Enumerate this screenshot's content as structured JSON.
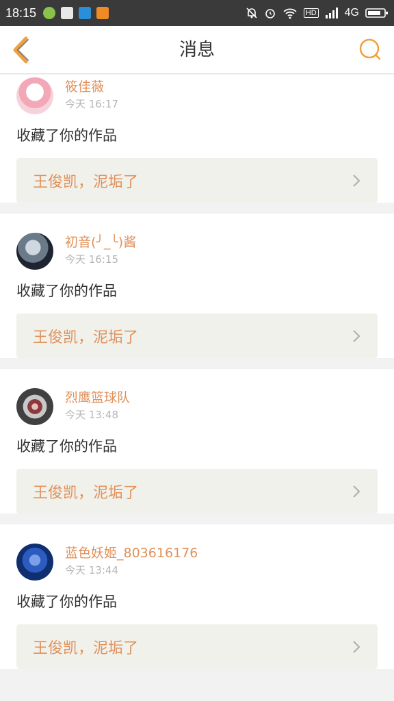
{
  "status_bar": {
    "time": "18:15",
    "network": "4G",
    "hd": "HD",
    "icons": [
      "app-icon-green",
      "app-icon-gallery",
      "app-icon-scan",
      "app-icon-orange",
      "mute-bell-icon",
      "alarm-icon",
      "wifi-icon",
      "hd-icon",
      "signal-icon",
      "battery-icon"
    ]
  },
  "header": {
    "title": "消息",
    "back_icon": "chevron-left-icon",
    "search_icon": "search-icon",
    "accent_color": "#f0a040"
  },
  "messages": [
    {
      "username": "筱佳薇",
      "time": "今天 16:17",
      "action": "收藏了你的作品",
      "work_title": "王俊凯，泥垢了",
      "avatar_color": "#f3d6dc"
    },
    {
      "username": "初音(╯_╰)酱",
      "time": "今天 16:15",
      "action": "收藏了你的作品",
      "work_title": "王俊凯，泥垢了",
      "avatar_color": "#2a3040"
    },
    {
      "username": "烈鹰篮球队",
      "time": "今天 13:48",
      "action": "收藏了你的作品",
      "work_title": "王俊凯，泥垢了",
      "avatar_color": "#5a3a3a"
    },
    {
      "username": "蓝色妖姬_803616176",
      "time": "今天 13:44",
      "action": "收藏了你的作品",
      "work_title": "王俊凯，泥垢了",
      "avatar_color": "#1f4fa8"
    }
  ]
}
